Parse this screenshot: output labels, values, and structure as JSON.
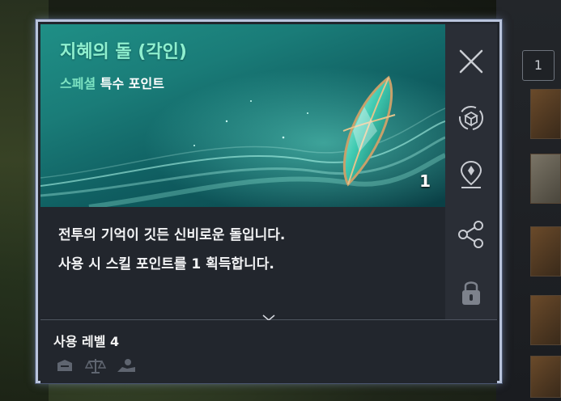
{
  "item": {
    "name": "지혜의 돌 (각인)",
    "category_highlight": "스페셜",
    "category_rest": "특수 포인트",
    "quantity": "1",
    "description_lines": [
      "전투의 기억이 깃든 신비로운 돌입니다.",
      "사용 시 스킬 포인트를 1 획득합니다."
    ],
    "use_level": "사용 레벨 4"
  },
  "background": {
    "right_counter": "1"
  },
  "sidebar": {
    "icons": [
      "close-icon",
      "dismantle-icon",
      "location-icon",
      "share-icon",
      "lock-icon"
    ]
  },
  "restriction_icons": [
    "storage-icon",
    "scale-icon",
    "trade-icon"
  ],
  "colors": {
    "title": "#8ff0cf",
    "category_highlight": "#7de3c2",
    "panel_border": "#b9c4dc",
    "hero_teal": "#1a7c78"
  }
}
